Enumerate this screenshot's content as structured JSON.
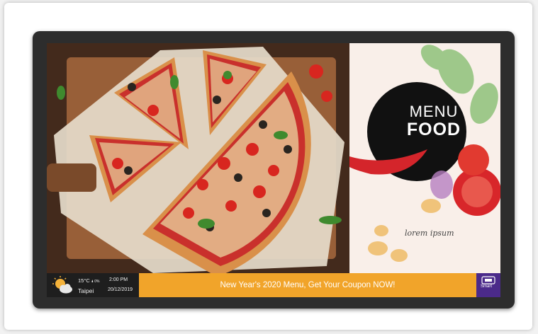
{
  "menu": {
    "line1": "MENU",
    "line2": "FOOD",
    "tagline": "lorem ipsum"
  },
  "ticker": {
    "message": "New Year's 2020 Menu, Get Your Coupon NOW!"
  },
  "weather": {
    "temperature": "15°C",
    "precip": "🌢 0%",
    "city": "Taipei",
    "time": "2:00 PM",
    "date": "20/12/2019",
    "icon": "partly-cloudy-icon"
  },
  "brand": {
    "label": "Smart",
    "icon": "smart-logo-icon"
  },
  "colors": {
    "ticker_bg": "#f1a42a",
    "weather_bg": "#1e1e1e",
    "brand_bg": "#4b2a8a",
    "menu_circle": "#111111",
    "art_bg": "#f9efe9"
  }
}
